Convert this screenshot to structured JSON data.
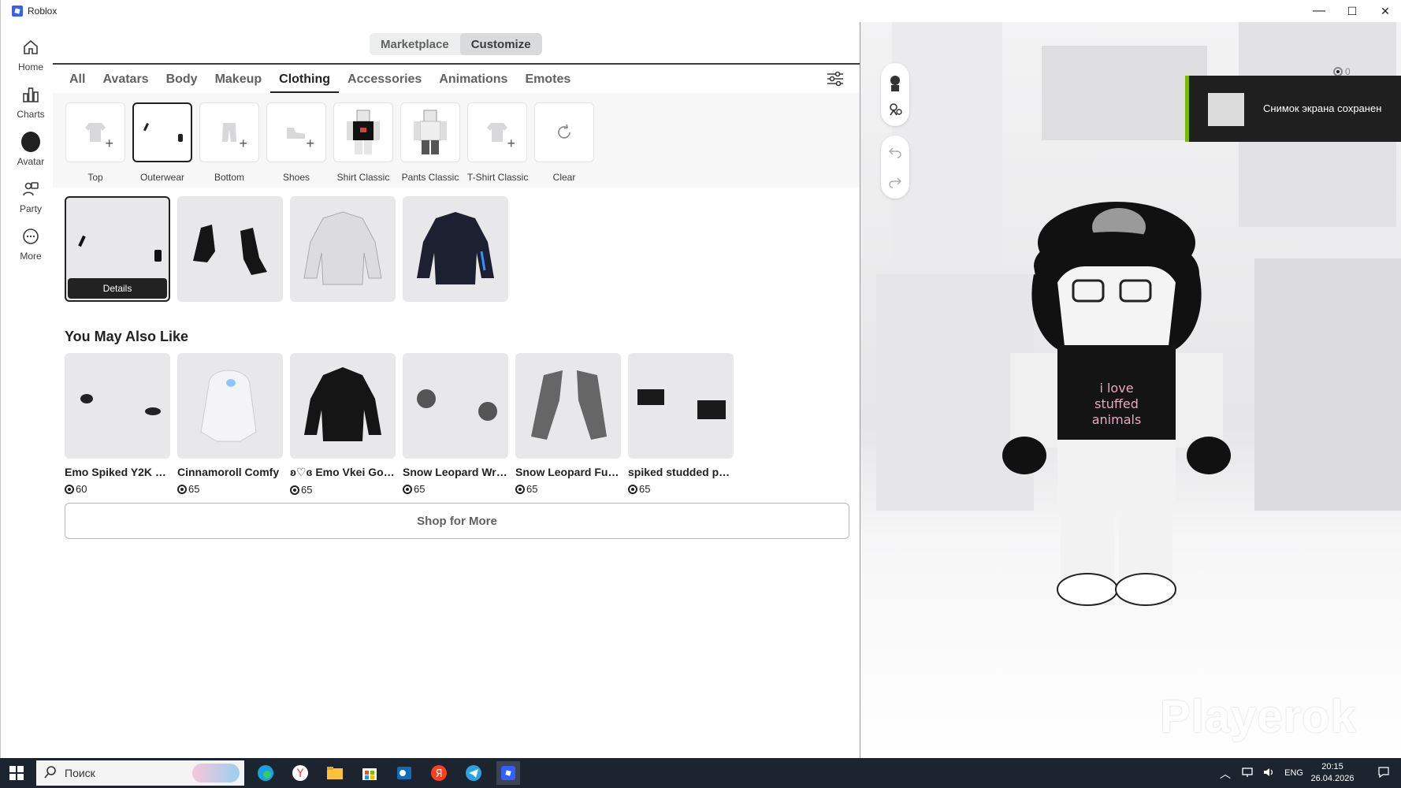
{
  "window": {
    "title": "Roblox",
    "minimize": "—",
    "maximize": "☐",
    "close": "✕"
  },
  "sidebar": {
    "items": [
      {
        "label": "Home",
        "icon": "home-icon"
      },
      {
        "label": "Charts",
        "icon": "charts-icon"
      },
      {
        "label": "Avatar",
        "icon": "avatar-icon",
        "active": true
      },
      {
        "label": "Party",
        "icon": "party-icon"
      },
      {
        "label": "More",
        "icon": "more-icon"
      }
    ]
  },
  "header": {
    "marketplace": "Marketplace",
    "customize": "Customize"
  },
  "tabs": [
    "All",
    "Avatars",
    "Body",
    "Makeup",
    "Clothing",
    "Accessories",
    "Animations",
    "Emotes"
  ],
  "subcategories": [
    "Top",
    "Outerwear",
    "Bottom",
    "Shoes",
    "Shirt Classic",
    "Pants Classic",
    "T-Shirt Classic",
    "Clear"
  ],
  "owned": {
    "details_label": "Details"
  },
  "recommendations": {
    "title": "You May Also Like",
    "items": [
      {
        "name": "Emo Spiked Y2K Le...",
        "price": "60"
      },
      {
        "name": "Cinnamoroll Comfy",
        "price": "65"
      },
      {
        "name": "ʚ♡ɞ Emo Vkei Goth...",
        "price": "65"
      },
      {
        "name": "Snow Leopard Wris...",
        "price": "65"
      },
      {
        "name": "Snow Leopard Fur ...",
        "price": "65"
      },
      {
        "name": "spiked studded pu...",
        "price": "65"
      }
    ],
    "shop_more": "Shop for More"
  },
  "viewport": {
    "toast_text": "Снимок экрана сохранен",
    "watermark": "Playerok",
    "robux_balance": "0"
  },
  "taskbar": {
    "search_placeholder": "Поиск",
    "lang": "ENG",
    "time": "20:15",
    "date": "26.04.2026"
  },
  "colors": {
    "accent_toast": "#76b900",
    "taskbar": "#1c2430",
    "selected_border": "#222222"
  }
}
